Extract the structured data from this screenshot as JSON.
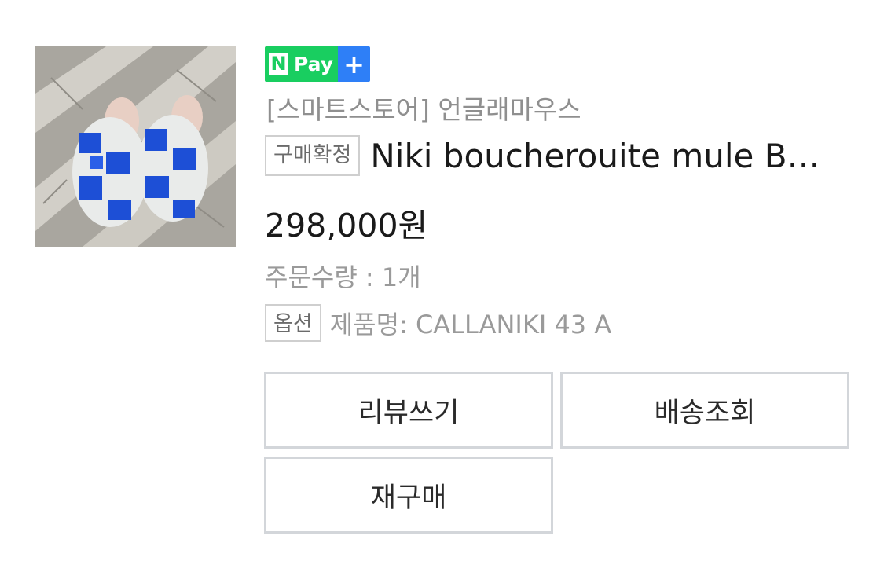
{
  "npay": {
    "n_letter": "N",
    "pay_label": "Pay",
    "plus_symbol": "+",
    "colors": {
      "green": "#19ce60",
      "blue": "#2e7ff7"
    }
  },
  "order": {
    "store_name": "[스마트스토어] 언글래마우스",
    "status_tag": "구매확정",
    "product_name": "Niki boucherouite mule B…",
    "price": "298,000원",
    "quantity": "주문수량 : 1개",
    "option_tag": "옵션",
    "option_value": "제품명: CALLANIKI 43 A"
  },
  "actions": {
    "write_review": "리뷰쓰기",
    "track_shipping": "배송조회",
    "rebuy": "재구매"
  },
  "icons": {
    "product_image": "product-thumbnail",
    "npay_logo": "npay-plus-logo"
  }
}
